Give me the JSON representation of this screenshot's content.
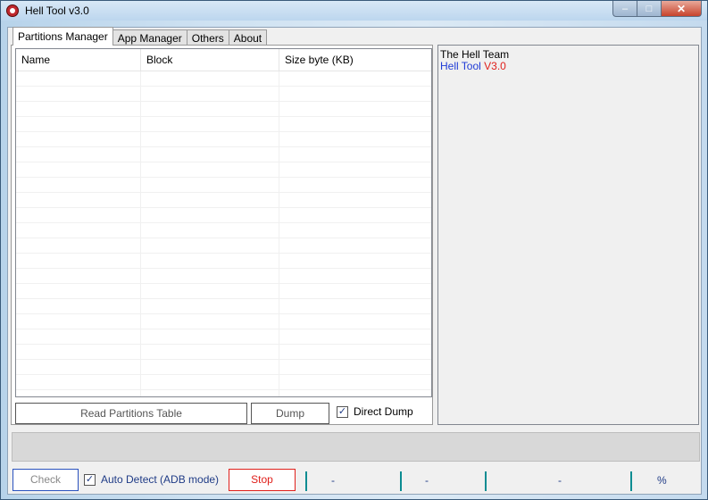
{
  "window": {
    "title": "Hell Tool v3.0",
    "controls": {
      "minimize": "–",
      "maximize": "□",
      "close": "✕"
    }
  },
  "tabs": [
    {
      "label": "Partitions Manager",
      "active": true
    },
    {
      "label": "App Manager",
      "active": false
    },
    {
      "label": "Others",
      "active": false
    },
    {
      "label": "About",
      "active": false
    }
  ],
  "partitions": {
    "columns": [
      "Name",
      "Block",
      "Size byte (KB)"
    ],
    "rows": [],
    "read_button": "Read Partitions Table",
    "dump_button": "Dump",
    "direct_dump": {
      "label": "Direct Dump",
      "checked": true
    }
  },
  "log": {
    "line1": "The Hell Team",
    "line2_app": "Hell Tool",
    "line2_version": "V3.0",
    "colors": {
      "app": "#1f3bd6",
      "version": "#e0201b"
    }
  },
  "progress": {
    "value": 0
  },
  "bottom": {
    "check_button": "Check",
    "auto_detect": {
      "label": "Auto Detect (ADB mode)",
      "checked": true
    },
    "stop_button": "Stop",
    "status1": "-",
    "status2": "-",
    "status3": "-",
    "percent": "%"
  },
  "colors": {
    "accent": "#1f3b86",
    "stop": "#e0201b",
    "separator": "#0b8c92"
  }
}
